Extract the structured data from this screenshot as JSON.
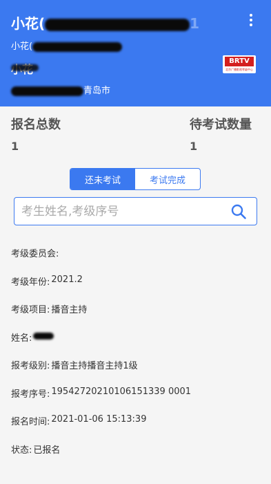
{
  "header": {
    "title": "小花(",
    "title_tail": "1",
    "subtitle": "小花(",
    "name": "小花",
    "address": "青岛市"
  },
  "logo": {
    "brand": "BRTV",
    "caption": "北京广播影视考级中心"
  },
  "stats": {
    "total_label": "报名总数",
    "total_value": "1",
    "pending_label": "待考试数量",
    "pending_value": "1"
  },
  "tabs": [
    {
      "label": "还未考试",
      "active": true
    },
    {
      "label": "考试完成",
      "active": false
    }
  ],
  "search": {
    "placeholder": "考生姓名,考级序号",
    "value": ""
  },
  "details": {
    "committee": {
      "label": "考级委员会:",
      "value": ""
    },
    "year": {
      "label": "考级年份:",
      "value": "2021.2"
    },
    "subject": {
      "label": "考级项目:",
      "value": "播音主持"
    },
    "name": {
      "label": "姓名:",
      "value": ""
    },
    "level": {
      "label": "报考级别:",
      "value": "播音主持播音主持1级"
    },
    "serial": {
      "label": "报考序号:",
      "value": "19542720210106151339 0001"
    },
    "time": {
      "label": "报名时间:",
      "value": "2021-01-06 15:13:39"
    },
    "status": {
      "label": "状态:",
      "value": "已报名"
    }
  },
  "colors": {
    "primary": "#3b79f0",
    "header_text": "#ffffff",
    "background": "#f5f5f5"
  },
  "icons": [
    "more-vertical-icon",
    "search-icon",
    "brtv-logo"
  ]
}
